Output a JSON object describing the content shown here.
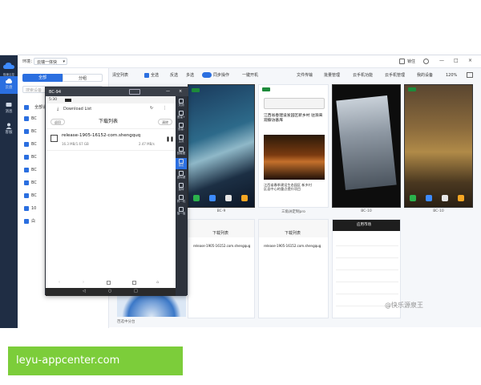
{
  "topbar": {
    "env_label": "环境：",
    "env_value": "云瑞一体快",
    "right_label": "锁住",
    "window_min": "—",
    "window_max": "□",
    "window_close": "×"
  },
  "rail": {
    "logo_text": "极速云控",
    "items": [
      {
        "label": "云盘"
      },
      {
        "label": "消息"
      },
      {
        "label": "客服"
      }
    ]
  },
  "left_panel": {
    "tab_all": "全部",
    "tab_group": "分组",
    "search_placeholder": "搜索设备",
    "select_all": "全部设备",
    "items": [
      "BC",
      "BC",
      "BC",
      "BC",
      "BC",
      "BC",
      "BC",
      "10",
      "白"
    ]
  },
  "toolbar": {
    "items": [
      "清空列表",
      "全选",
      "反选",
      "多选",
      "同步操作",
      "一键开机",
      "文件传输",
      "批量管理",
      "云手机功能",
      "云手机管理",
      "我的设备",
      "120%"
    ]
  },
  "devices": [
    {
      "label": "BC-9"
    },
    {
      "label": "三角洲定制pro"
    },
    {
      "label": "BC-10"
    },
    {
      "label": "BC-10"
    }
  ],
  "news_card": {
    "title": "江西省春建设发园区新乡村 驻滁来观察访基库",
    "lines": [
      "江西省春季建设生态园区 新乡村",
      "区县中心的重点提升项目"
    ],
    "caption": "三角洲定制pro"
  },
  "lower_cards": [
    {
      "header": "下载列表",
      "line": "release-1905-16152.com.shengqug"
    },
    {
      "header": "下载列表",
      "line": "release-1905-16152.com.shengqug"
    },
    {
      "header": "应用市场"
    }
  ],
  "lower_left_caption": "芭选中分台",
  "overlay": {
    "title": "BC-94",
    "status_time": "5:30",
    "download_list_label": "Download List",
    "page_title": "下载列表",
    "back_label": "返回",
    "clear_label": "清除",
    "file_name": "release-1905-16152-com.shengquq",
    "file_progress": "16.3 MB/1.67 GB",
    "file_speed": "2.47 MB/s",
    "side_buttons": [
      "关闭",
      "音量+",
      "音量-",
      "主页",
      "回截图",
      "锁定",
      "虚拟键",
      "旋转",
      "同一机",
      "摇一摇"
    ]
  },
  "watermark": "@快乐源泉王",
  "banner": {
    "text": "leyu-appcenter.com"
  },
  "colors": {
    "accent": "#2b6fe0",
    "rail": "#1f2d44",
    "banner": "#7ccd3a",
    "overlay_bar": "#3a3f48"
  }
}
